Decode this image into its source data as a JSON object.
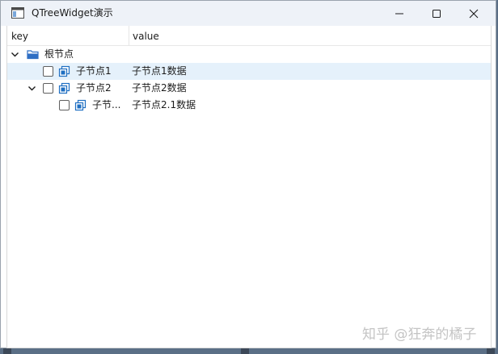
{
  "window": {
    "title": "QTreeWidget演示",
    "controls": [
      "minimize-icon",
      "maximize-icon",
      "close-icon"
    ]
  },
  "tree": {
    "columns": [
      {
        "label": "key"
      },
      {
        "label": "value"
      }
    ],
    "rows": [
      {
        "key": "根节点",
        "value": "",
        "icon": "folder-icon",
        "expanded": true,
        "checkbox": false,
        "selected": false,
        "level": 0
      },
      {
        "key": "子节点1",
        "value": "子节点1数据",
        "icon": "node-icon",
        "expanded": null,
        "checkbox": true,
        "checked": false,
        "selected": true,
        "level": 1
      },
      {
        "key": "子节点2",
        "value": "子节点2数据",
        "icon": "node-icon",
        "expanded": true,
        "checkbox": true,
        "checked": false,
        "selected": false,
        "level": 1
      },
      {
        "key": "子节...",
        "value": "子节点2.1数据",
        "icon": "node-icon",
        "expanded": null,
        "checkbox": true,
        "checked": false,
        "selected": false,
        "level": 2
      }
    ]
  },
  "watermark": "知乎 @狂奔的橘子",
  "colors": {
    "titlebar": "#eef2f8",
    "selection": "#e5f1fb",
    "folder": "#2f6fc4",
    "node_icon": "#1f6fc2",
    "desktop": "#5b6f86"
  }
}
